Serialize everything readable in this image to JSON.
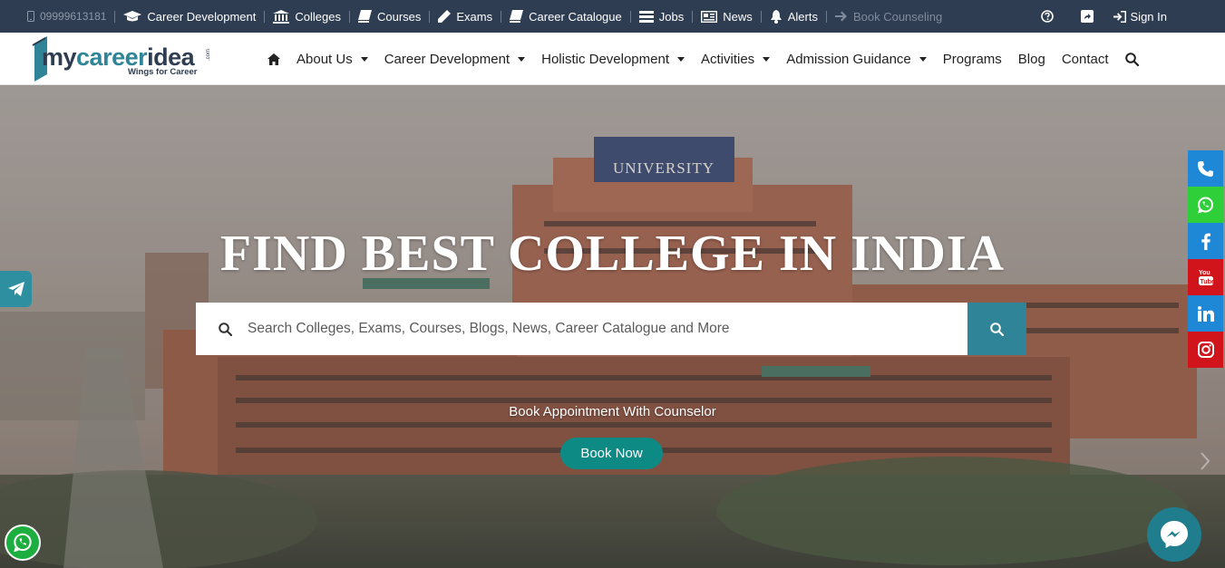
{
  "topbar": {
    "phone": "09999613181",
    "links": [
      "Career Development",
      "Colleges",
      "Courses",
      "Exams",
      "Career Catalogue",
      "Jobs",
      "News",
      "Alerts"
    ],
    "book_counseling": "Book Counseling",
    "sign_in": "Sign In"
  },
  "logo": {
    "name": "mycareeridea",
    "suffix": ".com",
    "tagline": "Wings for Career"
  },
  "nav": {
    "items": [
      "About Us",
      "Career Development",
      "Holistic Development",
      "Activities",
      "Admission Guidance",
      "Programs",
      "Blog",
      "Contact"
    ]
  },
  "hero": {
    "building_sign": "UNIVERSITY",
    "title": "FIND BEST COLLEGE IN INDIA",
    "search_placeholder": "Search Colleges, Exams, Courses, Blogs, News, Career Catalogue and More",
    "book_text": "Book Appointment With Counselor",
    "book_button": "Book Now"
  },
  "colors": {
    "topbar_bg": "#2f3d52",
    "brand_teal": "#2f8497",
    "book_button": "#0e8a84",
    "phone": "#1e88d6",
    "whatsapp": "#2fcf3a",
    "facebook": "#1e88d6",
    "youtube": "#d1141b",
    "linkedin": "#1e88d6",
    "instagram": "#d1141b"
  },
  "icons": [
    "mobile-icon",
    "graduation-cap-icon",
    "bank-icon",
    "book-icon",
    "pencil-icon",
    "book-icon",
    "list-icon",
    "newspaper-icon",
    "bell-icon",
    "arrow-right-icon",
    "question-circle-icon",
    "share-square-icon",
    "sign-in-icon",
    "home-icon",
    "search-icon",
    "telegram-icon",
    "phone-icon",
    "whatsapp-icon",
    "facebook-icon",
    "youtube-icon",
    "linkedin-icon",
    "instagram-icon",
    "messenger-icon"
  ]
}
